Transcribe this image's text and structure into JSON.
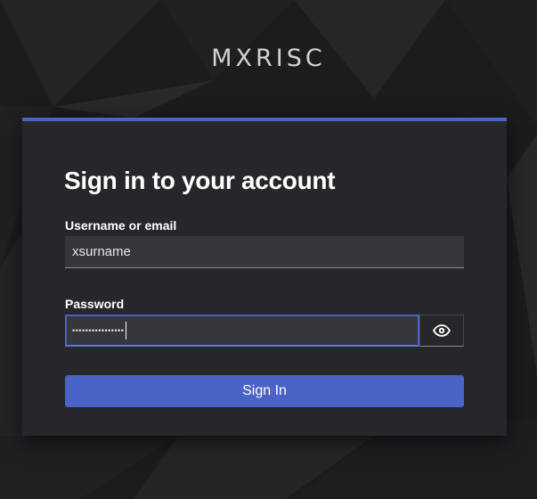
{
  "brand": {
    "name": "MXRISC"
  },
  "login": {
    "title": "Sign in to your account",
    "username_label": "Username or email",
    "username_value": "xsurname",
    "password_label": "Password",
    "password_masked": "••••••••••••••••",
    "signin_label": "Sign In"
  },
  "icons": {
    "password_toggle": "eye-icon"
  },
  "colors": {
    "accent": "#4a63c6",
    "card_background": "#26272b",
    "page_background": "#1c1c1e",
    "input_background": "#36373b"
  }
}
